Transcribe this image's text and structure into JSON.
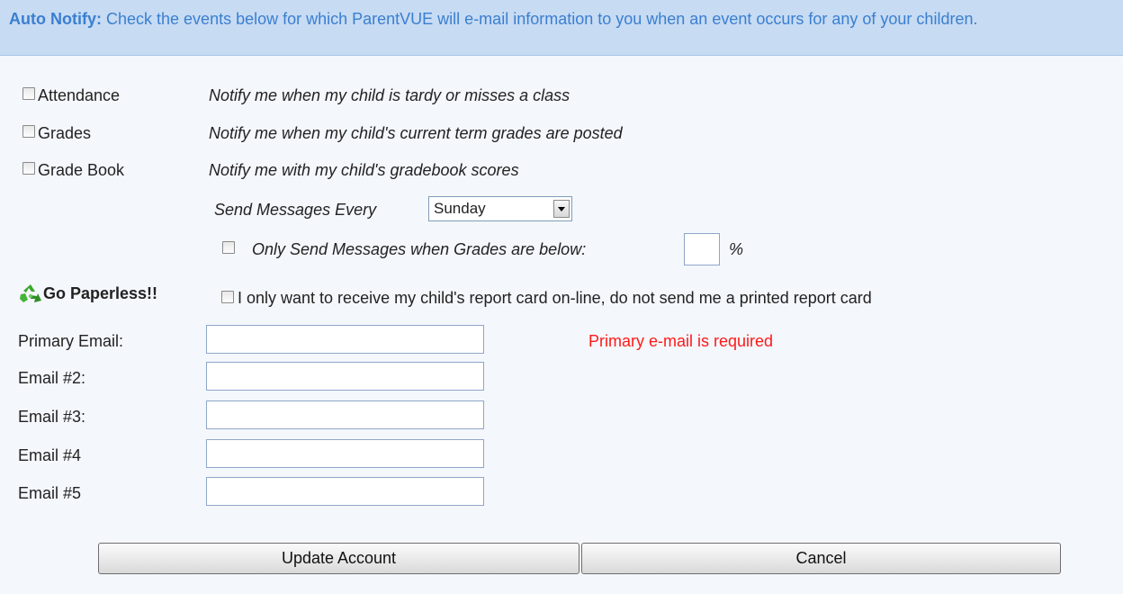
{
  "header": {
    "title": "Auto Notify:",
    "description": "Check the events below for which ParentVUE will e-mail information to you when an event occurs for any of your children."
  },
  "events": [
    {
      "label": "Attendance",
      "description": "Notify me when my child is tardy or misses a class",
      "checked": false
    },
    {
      "label": "Grades",
      "description": "Notify me when my child's current term grades are posted",
      "checked": false
    },
    {
      "label": "Grade Book",
      "description": "Notify me with my child's gradebook scores",
      "checked": false
    }
  ],
  "schedule": {
    "label": "Send Messages Every",
    "selected": "Sunday"
  },
  "threshold": {
    "label": "Only Send Messages when Grades are below:",
    "value": "",
    "unit": "%",
    "checked": false
  },
  "paperless": {
    "title": "Go Paperless!!",
    "icon": "recycle-icon",
    "option": "I only want to receive my child's report card on-line, do not send me a printed report card",
    "checked": false
  },
  "emails": [
    {
      "label": "Primary Email:",
      "value": ""
    },
    {
      "label": "Email #2:",
      "value": ""
    },
    {
      "label": "Email #3:",
      "value": ""
    },
    {
      "label": "Email #4",
      "value": ""
    },
    {
      "label": "Email #5",
      "value": ""
    }
  ],
  "validation": {
    "primary_error": "Primary e-mail is required",
    "error_color": "#ff1a1a"
  },
  "buttons": {
    "update": "Update Account",
    "cancel": "Cancel"
  },
  "colors": {
    "header_bg": "#c7dbf3",
    "header_text": "#3a7fd0",
    "page_bg": "#f4f7fc"
  }
}
